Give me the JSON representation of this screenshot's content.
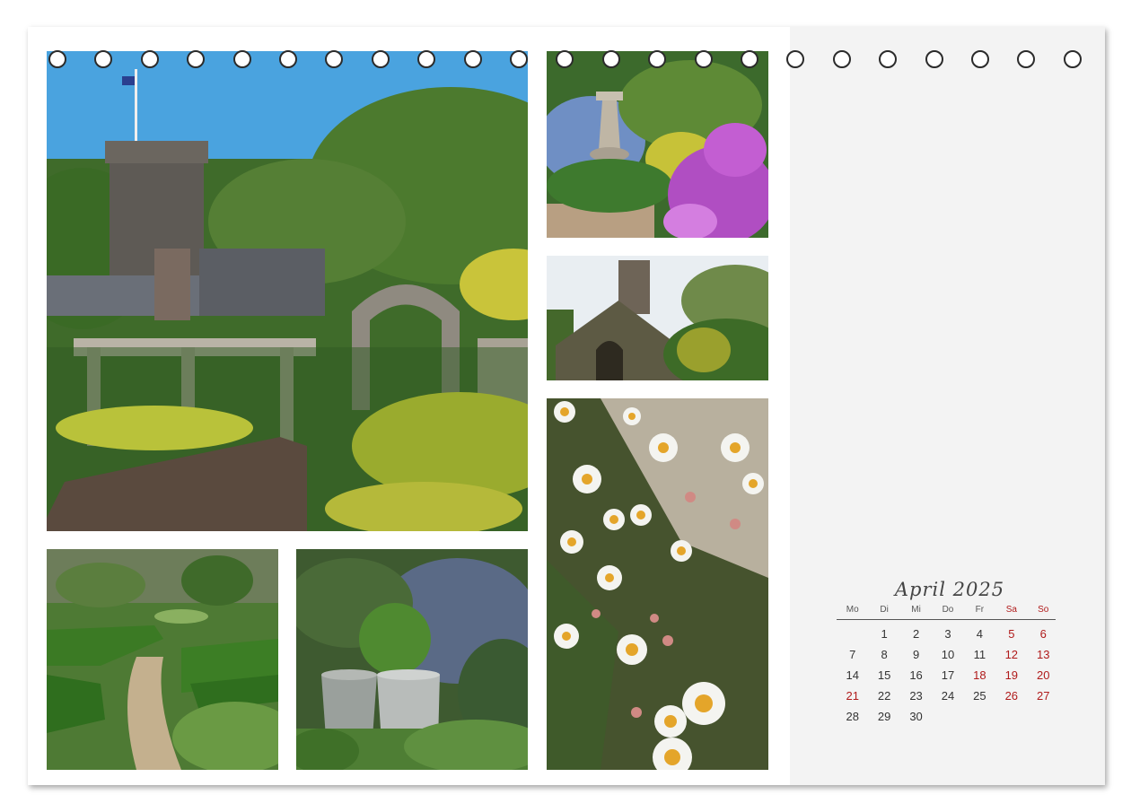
{
  "calendar": {
    "title": "April 2025",
    "weekdays": [
      "Mo",
      "Di",
      "Mi",
      "Do",
      "Fr",
      "Sa",
      "So"
    ],
    "weeks": [
      [
        "",
        "1",
        "2",
        "3",
        "4",
        "5",
        "6"
      ],
      [
        "7",
        "8",
        "9",
        "10",
        "11",
        "12",
        "13"
      ],
      [
        "14",
        "15",
        "16",
        "17",
        "18",
        "19",
        "20"
      ],
      [
        "21",
        "22",
        "23",
        "24",
        "25",
        "26",
        "27"
      ],
      [
        "28",
        "29",
        "30",
        "",
        "",
        "",
        ""
      ]
    ],
    "highlighted_days": [
      "5",
      "6",
      "12",
      "13",
      "18",
      "19",
      "20",
      "21",
      "26",
      "27"
    ]
  },
  "colors": {
    "holiday_red": "#b01b1b",
    "panel_grey": "#f3f3f3"
  },
  "photos": [
    {
      "id": "garden-tower",
      "label": "tower and arch garden"
    },
    {
      "id": "birdbath-flowers",
      "label": "birdbath and pink flowers"
    },
    {
      "id": "chapel",
      "label": "stone chapel"
    },
    {
      "id": "daisies",
      "label": "white daisies"
    },
    {
      "id": "hedge-garden",
      "label": "box hedge garden"
    },
    {
      "id": "watering-cans",
      "label": "watering cans"
    }
  ]
}
